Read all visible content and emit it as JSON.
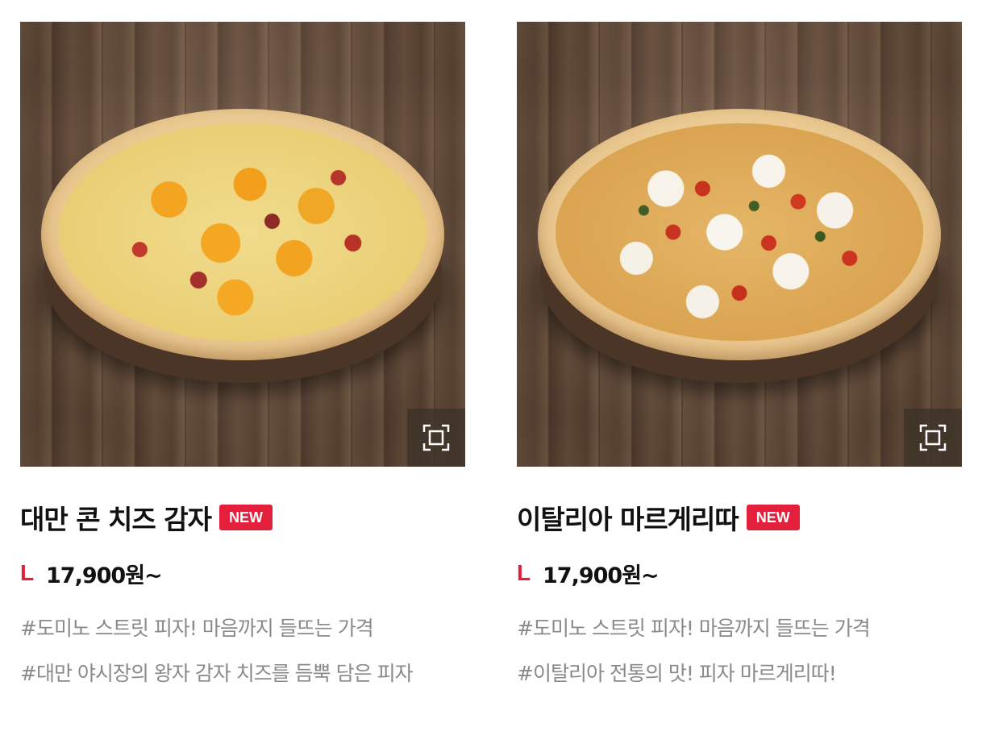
{
  "products": [
    {
      "name": "대만 콘 치즈 감자",
      "badge": "NEW",
      "size": "L",
      "price": "17,900원~",
      "tags": [
        "#도미노 스트릿 피자! 마음까지 들뜨는 가격",
        "#대만 야시장의 왕자 감자 치즈를 듬뿍 담은 피자"
      ],
      "zoom_icon": "expand-icon"
    },
    {
      "name": "이탈리아 마르게리따",
      "badge": "NEW",
      "size": "L",
      "price": "17,900원~",
      "tags": [
        "#도미노 스트릿 피자! 마음까지 들뜨는 가격",
        "#이탈리아 전통의 맛! 피자 마르게리따!"
      ],
      "zoom_icon": "expand-icon"
    }
  ],
  "colors": {
    "accent": "#e31f3b",
    "title": "#111111",
    "tag": "#8a8a8a"
  }
}
